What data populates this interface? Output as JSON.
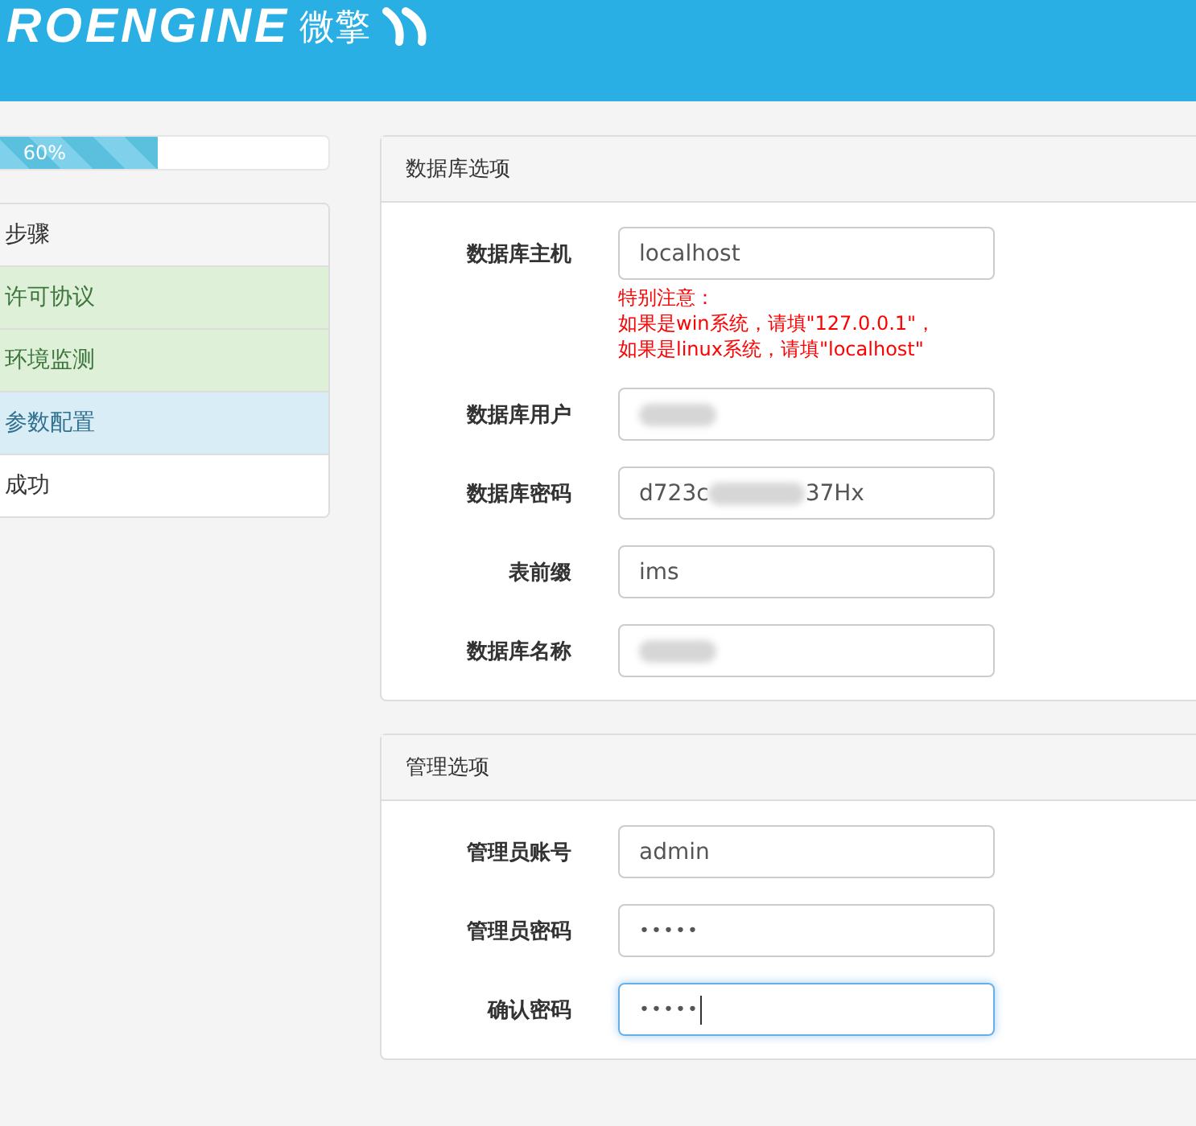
{
  "header": {
    "logo_text": "ROENGINE",
    "logo_cn": "微擎"
  },
  "progress": {
    "level": 0.6,
    "label": "60%"
  },
  "steps": {
    "title": "步骤",
    "items": [
      {
        "label": "许可协议",
        "color": "#dff0d8"
      },
      {
        "label": "环境监测",
        "color": "#dff0d8"
      },
      {
        "label": "参数配置",
        "color": "#d9edf7"
      },
      {
        "label": "成功",
        "color": "#ffffff"
      }
    ]
  },
  "panels": [
    {
      "title": "数据库选项",
      "fields": [
        {
          "label": "数据库主机",
          "kind": "text",
          "value": "localhost",
          "note": [
            "特别注意：",
            "如果是win系统，请填\"127.0.0.1\"，",
            "如果是linux系统，请填\"localhost\""
          ]
        },
        {
          "label": "数据库用户",
          "kind": "redacted"
        },
        {
          "label": "数据库密码",
          "kind": "redacted",
          "value": "d723c",
          "value_end": "37Hx"
        },
        {
          "label": "表前缀",
          "kind": "text",
          "value": "ims"
        },
        {
          "label": "数据库名称",
          "kind": "redacted"
        }
      ]
    },
    {
      "title": "管理选项",
      "fields": [
        {
          "label": "管理员账号",
          "kind": "text",
          "value": "admin"
        },
        {
          "label": "管理员密码",
          "kind": "password",
          "value": "•••••"
        },
        {
          "label": "确认密码",
          "kind": "password",
          "value": "•••••",
          "focused": true
        }
      ]
    }
  ]
}
